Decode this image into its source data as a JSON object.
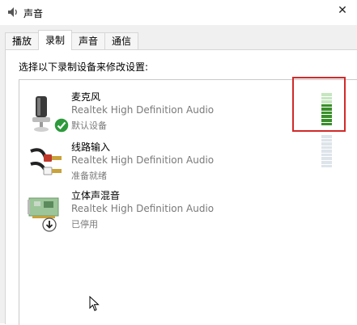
{
  "window": {
    "title": "声音",
    "close_glyph": "✕"
  },
  "tabs": [
    {
      "label": "播放"
    },
    {
      "label": "录制",
      "active": true
    },
    {
      "label": "声音"
    },
    {
      "label": "通信"
    }
  ],
  "instruction": "选择以下录制设备来修改设置:",
  "devices": [
    {
      "name": "麦克风",
      "driver": "Realtek High Definition Audio",
      "status": "默认设备",
      "icon": "microphone-icon",
      "badge": "default-check-icon",
      "meter_level": 0.7
    },
    {
      "name": "线路输入",
      "driver": "Realtek High Definition Audio",
      "status": "准备就绪",
      "icon": "line-in-cable-icon",
      "meter_level": 0
    },
    {
      "name": "立体声混音",
      "driver": "Realtek High Definition Audio",
      "status": "已停用",
      "icon": "sound-card-icon",
      "badge": "disabled-arrow-icon"
    }
  ],
  "colors": {
    "meter_active": "#3a8f2a",
    "meter_inactive": "#dde4ea",
    "highlight": "#d22a2a",
    "check_badge": "#2e9a3c"
  }
}
